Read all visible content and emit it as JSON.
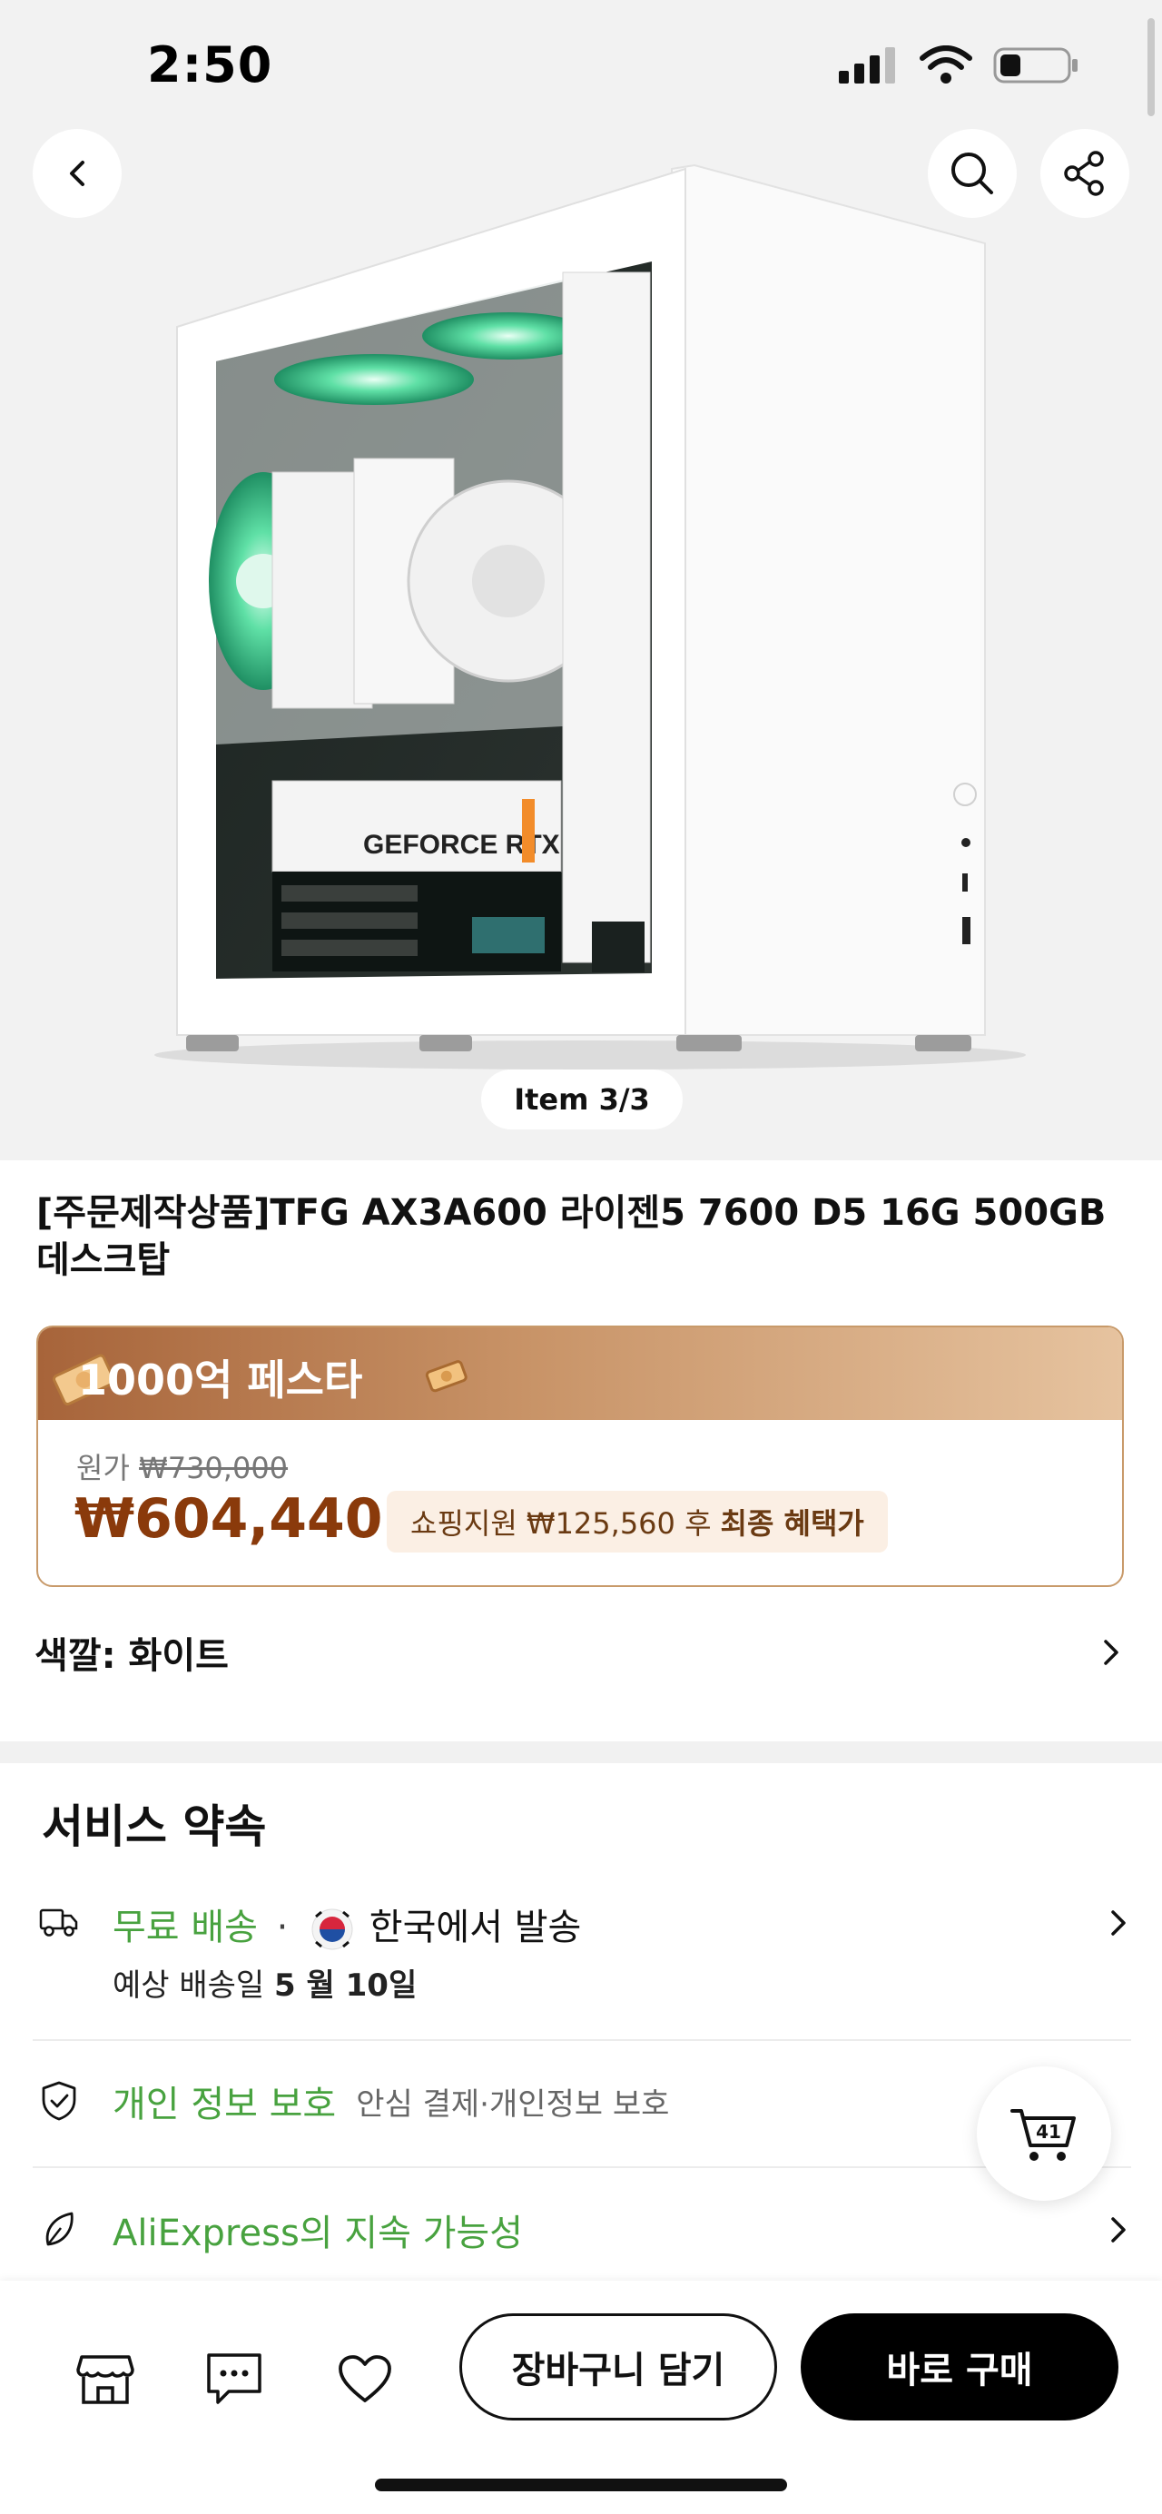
{
  "status_bar": {
    "time": "2:50"
  },
  "gallery": {
    "item_counter": "Item 3/3",
    "gpu_label": "GEFORCE RTX"
  },
  "product": {
    "title": "[주문제작상품]TFG AX3A600 라이젠5 7600 D5 16G 500GB 데스크탑"
  },
  "price": {
    "banner_text": "1000억 페스타",
    "original_label": "원가",
    "original_price": "₩730,000",
    "sale_price": "₩604,440",
    "benefit_text": "쇼핑지원 ₩125,560 후",
    "benefit_strong": "최종 혜택가"
  },
  "option": {
    "color_label": "색깔: 화이트"
  },
  "service": {
    "title": "서비스 약속",
    "shipping_free": "무료 배송",
    "shipping_sep": "·",
    "shipping_origin": "한국에서 발송",
    "delivery_label": "예상 배송일",
    "delivery_date": "5 월 10일",
    "privacy_title": "개인 정보 보호",
    "privacy_desc": "안심 결제·개인정보 보호",
    "sustainability": "AliExpress의 지속 가능성"
  },
  "cart_float": {
    "count": "41"
  },
  "bottom_bar": {
    "add_to_cart": "장바구니 담기",
    "buy_now": "바로 구매"
  },
  "colors": {
    "accent_green": "#48a23f",
    "sale_price": "#8a3a0b",
    "card_border": "#c89a6a",
    "banner_start": "#a7643a",
    "banner_end": "#e6c39f"
  }
}
